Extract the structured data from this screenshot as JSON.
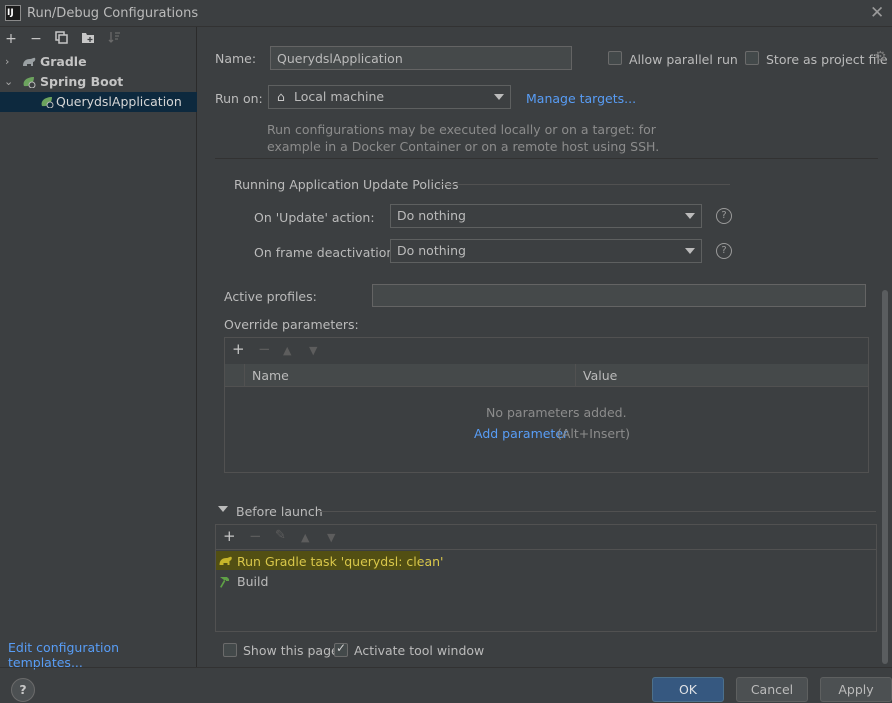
{
  "window": {
    "title": "Run/Debug Configurations",
    "app_icon_text": "IJ"
  },
  "left": {
    "toolbar": [
      "add-icon",
      "remove-icon",
      "copy-icon",
      "folder-icon",
      "sort-icon"
    ],
    "tree": [
      {
        "label": "Gradle",
        "expanded": false
      },
      {
        "label": "Spring Boot",
        "expanded": true
      },
      {
        "label": "QuerydslApplication",
        "selected": true
      }
    ],
    "edit_templates": "Edit configuration templates..."
  },
  "form": {
    "name_label": "Name:",
    "name_value": "QuerydslApplication",
    "allow_parallel": "Allow parallel run",
    "store_project": "Store as project file",
    "run_on_label": "Run on:",
    "run_on_value": "Local machine",
    "manage_targets": "Manage targets...",
    "hint_line1": "Run configurations may be executed locally or on a target: for",
    "hint_line2": "example in a Docker Container or on a remote host using SSH."
  },
  "update_policies": {
    "title": "Running Application Update Policies",
    "update_label": "On 'Update' action:",
    "update_value": "Do nothing",
    "frame_label": "On frame deactivation:",
    "frame_value": "Do nothing"
  },
  "profiles": {
    "label": "Active profiles:",
    "value": ""
  },
  "override": {
    "label": "Override parameters:",
    "columns": [
      "Name",
      "Value"
    ],
    "empty_text": "No parameters added.",
    "add_link": "Add parameter",
    "add_shortcut": "(Alt+Insert)"
  },
  "before_launch": {
    "title": "Before launch",
    "items": [
      "Run Gradle task 'querydsl: clean'",
      "Build"
    ],
    "highlight_color": "#524f13"
  },
  "footer": {
    "show_page": "Show this page",
    "activate_tool": "Activate tool window",
    "ok": "OK",
    "cancel": "Cancel",
    "apply": "Apply"
  },
  "colors": {
    "accent": "#589df6",
    "selection": "#0d293e",
    "primary_button": "#365880"
  }
}
